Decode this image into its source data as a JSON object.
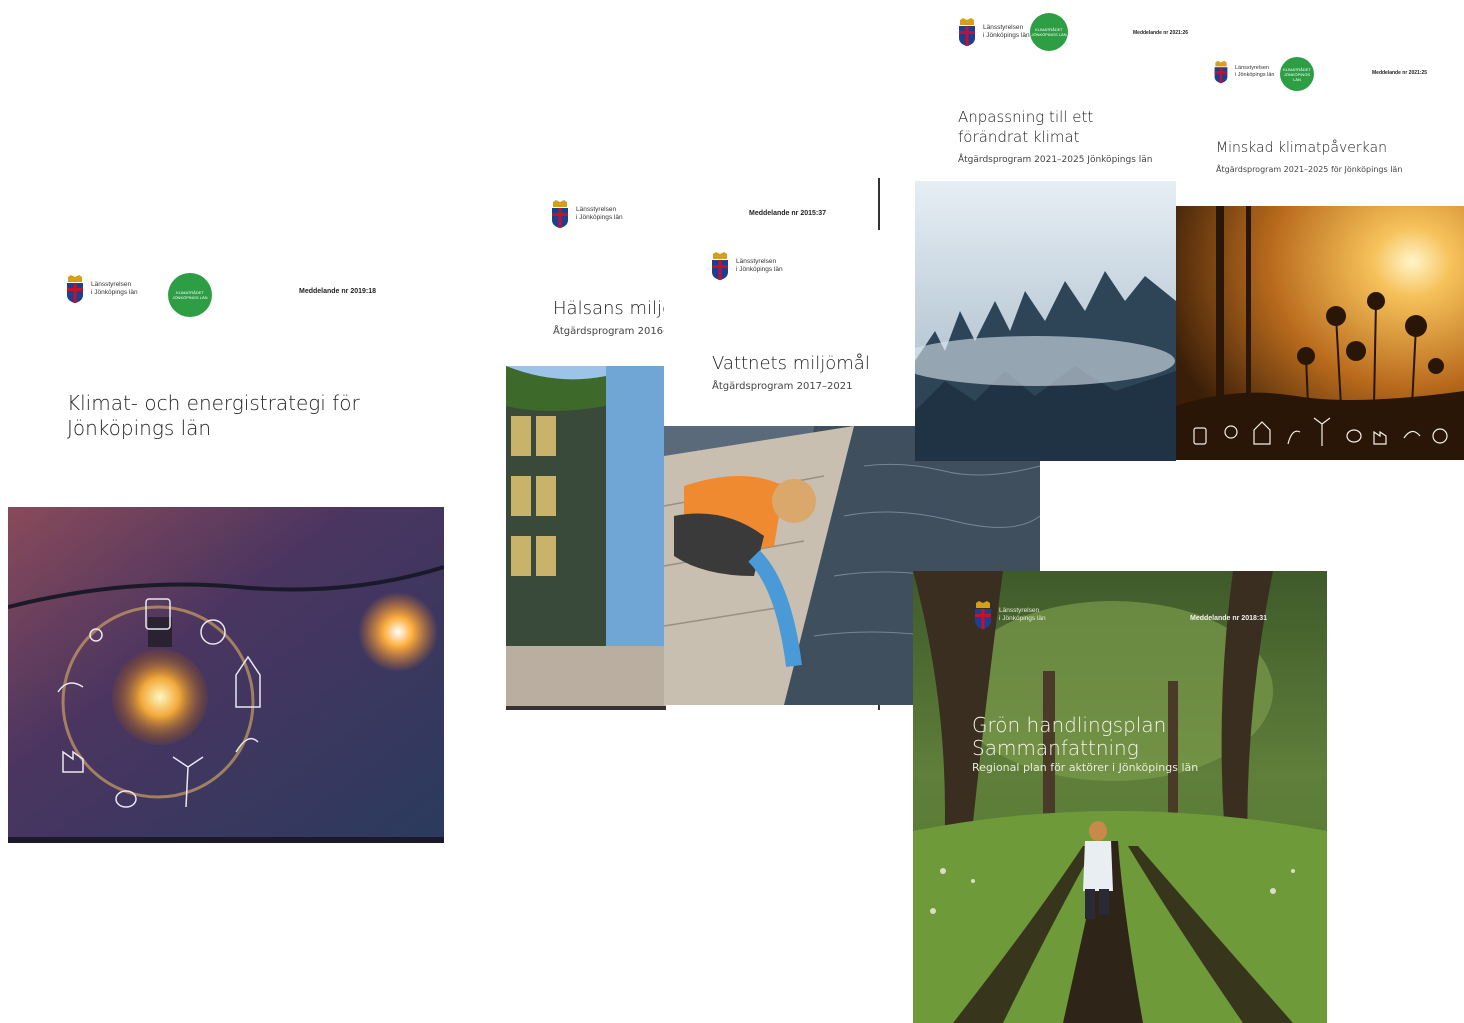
{
  "org": {
    "line1": "Länsstyrelsen",
    "line2": "i Jönköpings län"
  },
  "badge_text": "KLIMATRÅDET JÖNKÖPINGS LÄN",
  "colors": {
    "badge_green": "#2e9e45",
    "title_text": "#222222"
  },
  "covers": {
    "klimat": {
      "number": "Meddelande nr 2019:18",
      "title_line1": "Klimat- och energistrategi för",
      "title_line2": "Jönköpings län"
    },
    "halsans": {
      "number": "Meddelande nr 2015:37",
      "title": "Hälsans miljöı",
      "subtitle": "Åtgärdsprogram 2016-"
    },
    "vattnets": {
      "title": "Vattnets miljömål",
      "subtitle": "Åtgärdsprogram 2017–2021"
    },
    "anpassning": {
      "number": "Meddelande nr 2021:26",
      "title_line1": "Anpassning till ett",
      "title_line2": "förändrat klimat",
      "subtitle": "Åtgärdsprogram 2021–2025 Jönköpings län"
    },
    "minskad": {
      "number": "Meddelande nr 2021:25",
      "title": "Minskad klimatpåverkan",
      "subtitle": "Åtgärdsprogram 2021–2025 för Jönköpings län"
    },
    "gron": {
      "number": "Meddelande nr 2018:31",
      "title_line1": "Grön handlingsplan",
      "title_line2": "Sammanfattning",
      "subtitle": "Regional plan för aktörer i Jönköpings län"
    }
  },
  "icons": [
    "tram-icon",
    "sun-icon",
    "house-icon",
    "plant-icon",
    "wind-turbine-icon",
    "bee-icon",
    "factory-icon",
    "rain-cloud-icon",
    "people-icon"
  ]
}
